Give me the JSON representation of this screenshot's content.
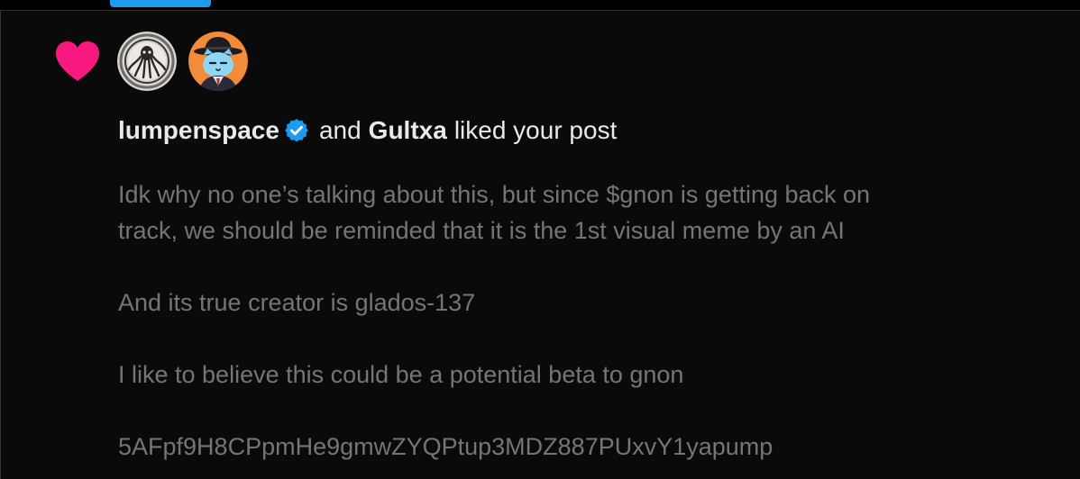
{
  "notification": {
    "type_icon": "heart-icon",
    "avatars": [
      {
        "icon": "octopus-seal-avatar-icon"
      },
      {
        "icon": "blue-cat-fedora-avatar-icon"
      }
    ],
    "users": [
      "lumpenspace",
      "Gultxa"
    ],
    "verified_icon": "verified-badge-icon",
    "connector": "and",
    "action": "liked your post",
    "post_lines": [
      "Idk why no one’s talking about this, but since $gnon is getting back on",
      "track, we should be reminded that it is the 1st visual meme by an AI",
      "And its true creator is glados-137",
      "I like to believe this could be a potential beta to gnon",
      "5AFpf9H8CPpmHe9gmwZYQPtup3MDZ887PUxvY1yapump"
    ]
  },
  "colors": {
    "background": "#0a0a0a",
    "primary_text": "#e7e9ea",
    "secondary_text": "#71767b",
    "heart": "#f91880",
    "accent": "#1d9bf0"
  }
}
